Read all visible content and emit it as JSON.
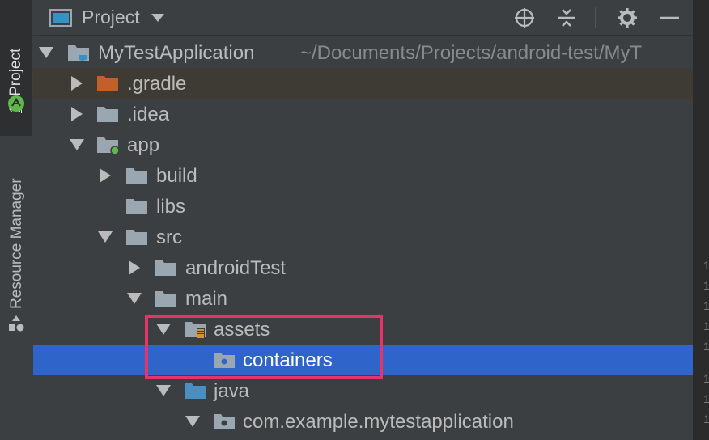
{
  "sidebar": {
    "project_tab": {
      "prefix": "1:",
      "label": " Project"
    },
    "resource_manager_label": "Resource Manager"
  },
  "header": {
    "title": "Project",
    "tools": [
      "locate-icon",
      "collapse-all-icon",
      "gear-icon",
      "minimize-icon"
    ]
  },
  "tree": {
    "root": {
      "label": "MyTestApplication",
      "path": "~/Documents/Projects/android-test/MyT"
    },
    "items": [
      {
        "label": ".gradle"
      },
      {
        "label": ".idea"
      },
      {
        "label": "app"
      },
      {
        "label": "build"
      },
      {
        "label": "libs"
      },
      {
        "label": "src"
      },
      {
        "label": "androidTest"
      },
      {
        "label": "main"
      },
      {
        "label": "assets"
      },
      {
        "label": "containers"
      },
      {
        "label": "java"
      },
      {
        "label": "com.example.mytestapplication"
      }
    ]
  },
  "gutter": {
    "digits": [
      "1",
      "1",
      "1",
      "1",
      "1",
      "1",
      "1",
      "1"
    ]
  },
  "colors": {
    "selection": "#2f65ca",
    "highlight_box": "#e6346b",
    "gradle_folder": "#c2602c",
    "source_folder": "#4a8fbf",
    "module_dot": "#5fb84a"
  }
}
